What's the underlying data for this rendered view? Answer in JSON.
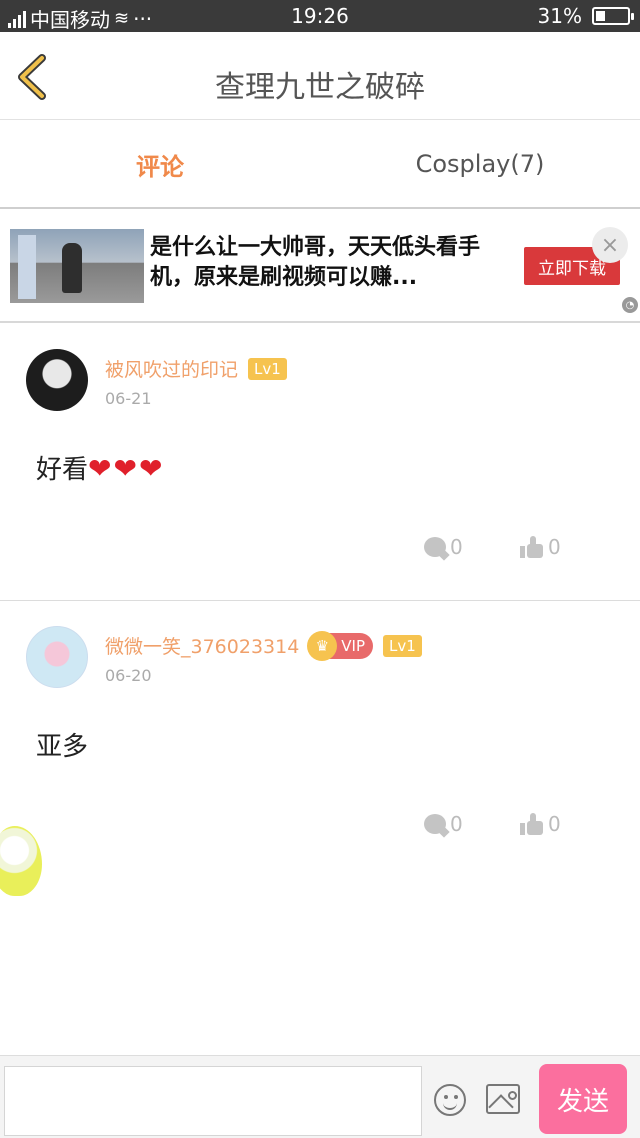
{
  "status_bar": {
    "carrier": "中国移动",
    "dots": "···",
    "time": "19:26",
    "battery_percent": "31%",
    "battery_level": 0.31
  },
  "header": {
    "title": "查理九世之破碎",
    "back_icon": "chevron-left-icon"
  },
  "tabs": [
    {
      "label": "评论",
      "active": true
    },
    {
      "label": "Cosplay(7)",
      "active": false
    }
  ],
  "ad": {
    "text": "是什么让一大帅哥，天天低头看手机，原来是刷视频可以赚...",
    "cta": "立即下载",
    "close": "×"
  },
  "comments": [
    {
      "username": "被风吹过的印记",
      "level": "Lv1",
      "vip": null,
      "date": "06-21",
      "text": "好看",
      "emoji": "❤❤❤",
      "reply_count": "0",
      "like_count": "0"
    },
    {
      "username": "微微一笑_376023314",
      "level": "Lv1",
      "vip": "VIP",
      "date": "06-20",
      "text": "亚多",
      "emoji": "",
      "reply_count": "0",
      "like_count": "0"
    }
  ],
  "bottom_bar": {
    "input_value": "",
    "send_label": "发送"
  },
  "colors": {
    "accent_orange": "#f0894a",
    "level_badge": "#f6c34f",
    "vip_badge": "#e86a6a",
    "send_button": "#fb6f9e",
    "ad_button": "#d9393b"
  }
}
